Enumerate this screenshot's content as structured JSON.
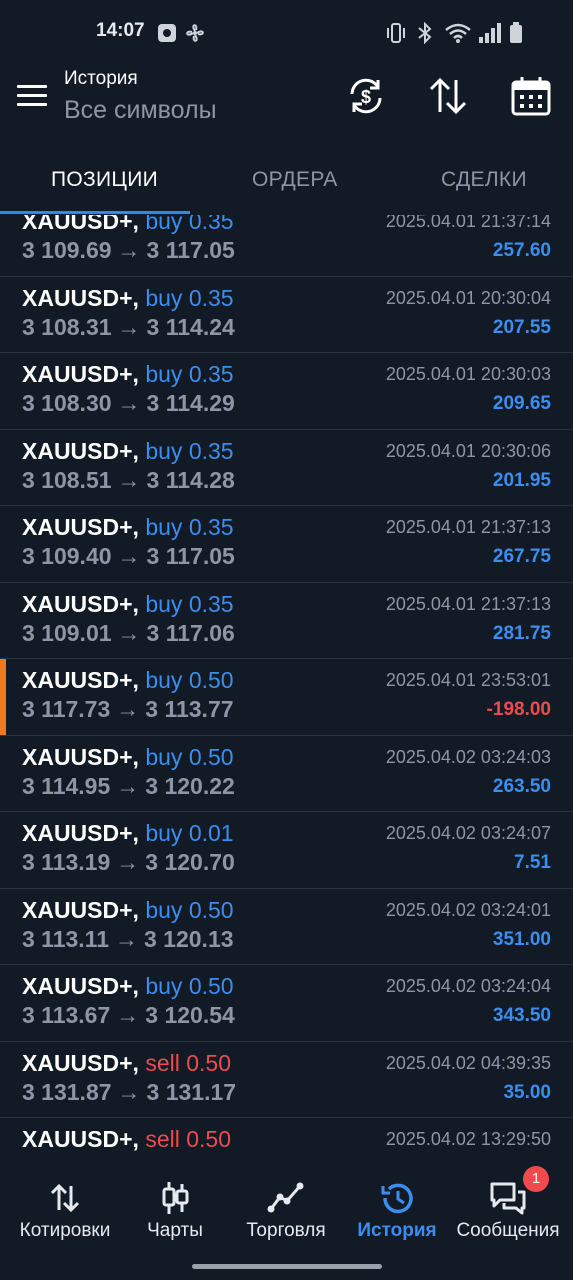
{
  "statusbar": {
    "time": "14:07"
  },
  "header": {
    "title": "История",
    "subtitle": "Все символы"
  },
  "tabs": [
    {
      "label": "ПОЗИЦИИ",
      "active": true
    },
    {
      "label": "ОРДЕРА",
      "active": false
    },
    {
      "label": "СДЕЛКИ",
      "active": false
    }
  ],
  "positions": [
    {
      "symbol": "XAUUSD+,",
      "side": "buy",
      "volume": "0.35",
      "open": "3 109.69",
      "close": "3 117.05",
      "time": "2025.04.01 21:37:14",
      "profit": "257.60"
    },
    {
      "symbol": "XAUUSD+,",
      "side": "buy",
      "volume": "0.35",
      "open": "3 108.31",
      "close": "3 114.24",
      "time": "2025.04.01 20:30:04",
      "profit": "207.55"
    },
    {
      "symbol": "XAUUSD+,",
      "side": "buy",
      "volume": "0.35",
      "open": "3 108.30",
      "close": "3 114.29",
      "time": "2025.04.01 20:30:03",
      "profit": "209.65"
    },
    {
      "symbol": "XAUUSD+,",
      "side": "buy",
      "volume": "0.35",
      "open": "3 108.51",
      "close": "3 114.28",
      "time": "2025.04.01 20:30:06",
      "profit": "201.95"
    },
    {
      "symbol": "XAUUSD+,",
      "side": "buy",
      "volume": "0.35",
      "open": "3 109.40",
      "close": "3 117.05",
      "time": "2025.04.01 21:37:13",
      "profit": "267.75"
    },
    {
      "symbol": "XAUUSD+,",
      "side": "buy",
      "volume": "0.35",
      "open": "3 109.01",
      "close": "3 117.06",
      "time": "2025.04.01 21:37:13",
      "profit": "281.75"
    },
    {
      "symbol": "XAUUSD+,",
      "side": "buy",
      "volume": "0.50",
      "open": "3 117.73",
      "close": "3 113.77",
      "time": "2025.04.01 23:53:01",
      "profit": "-198.00"
    },
    {
      "symbol": "XAUUSD+,",
      "side": "buy",
      "volume": "0.50",
      "open": "3 114.95",
      "close": "3 120.22",
      "time": "2025.04.02 03:24:03",
      "profit": "263.50"
    },
    {
      "symbol": "XAUUSD+,",
      "side": "buy",
      "volume": "0.01",
      "open": "3 113.19",
      "close": "3 120.70",
      "time": "2025.04.02 03:24:07",
      "profit": "7.51"
    },
    {
      "symbol": "XAUUSD+,",
      "side": "buy",
      "volume": "0.50",
      "open": "3 113.11",
      "close": "3 120.13",
      "time": "2025.04.02 03:24:01",
      "profit": "351.00"
    },
    {
      "symbol": "XAUUSD+,",
      "side": "buy",
      "volume": "0.50",
      "open": "3 113.67",
      "close": "3 120.54",
      "time": "2025.04.02 03:24:04",
      "profit": "343.50"
    },
    {
      "symbol": "XAUUSD+,",
      "side": "sell",
      "volume": "0.50",
      "open": "3 131.87",
      "close": "3 131.17",
      "time": "2025.04.02 04:39:35",
      "profit": "35.00"
    },
    {
      "symbol": "XAUUSD+,",
      "side": "sell",
      "volume": "0.50",
      "open": "",
      "close": "",
      "time": "2025.04.02 13:29:50",
      "profit": ""
    }
  ],
  "arrow": "→",
  "bottom_nav": [
    {
      "label": "Котировки",
      "icon": "quotes-icon",
      "active": false
    },
    {
      "label": "Чарты",
      "icon": "candles-icon",
      "active": false
    },
    {
      "label": "Торговля",
      "icon": "trade-line-icon",
      "active": false
    },
    {
      "label": "История",
      "icon": "history-icon",
      "active": true
    },
    {
      "label": "Сообщения",
      "icon": "chat-icon",
      "active": false,
      "badge": "1"
    }
  ],
  "colors": {
    "accent": "#3b8ef0",
    "loss": "#f04a4f",
    "highlight": "#f07a1a",
    "background": "#121a26"
  }
}
